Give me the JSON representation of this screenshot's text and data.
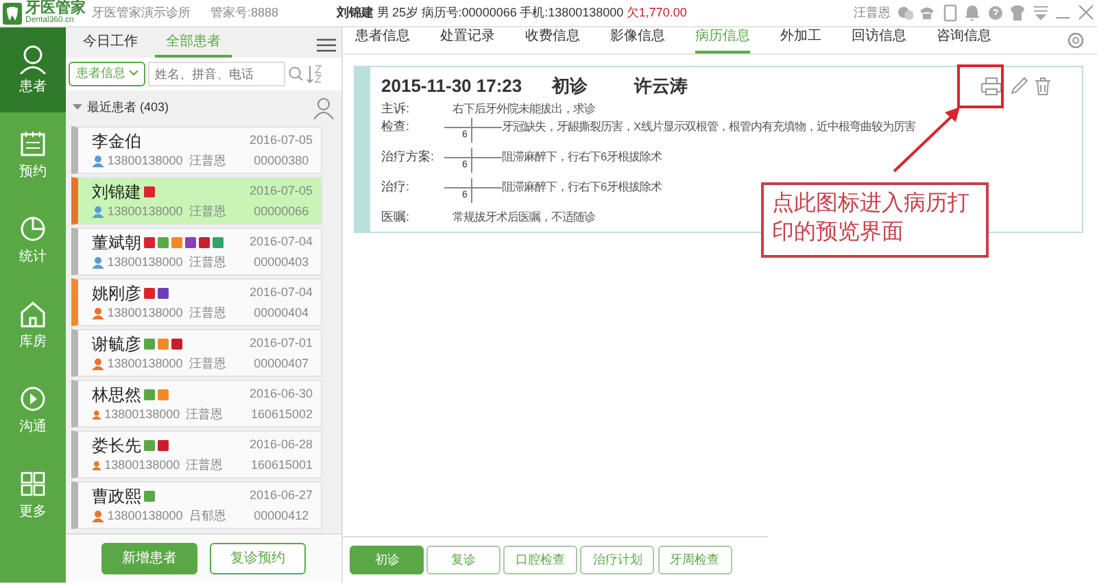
{
  "app": {
    "logo_title": "牙医管家",
    "logo_subtitle": "Dental360.cn",
    "clinic": "牙医管家演示诊所",
    "account": "管家号:8888"
  },
  "patient_header": {
    "name": "刘锦建",
    "gender": "男",
    "age": "25岁",
    "record_no": "病历号:00000066",
    "phone": "手机:13800138000",
    "debt": "欠1,770.00"
  },
  "user": "汪普恩",
  "sidebar": {
    "items": [
      {
        "label": "患者",
        "kind": "person",
        "selected": true
      },
      {
        "label": "预约",
        "kind": "calendar",
        "selected": false
      },
      {
        "label": "统计",
        "kind": "pie",
        "selected": false
      },
      {
        "label": "库房",
        "kind": "house",
        "selected": false
      },
      {
        "label": "沟通",
        "kind": "play",
        "selected": false
      },
      {
        "label": "更多",
        "kind": "grid",
        "selected": false
      }
    ]
  },
  "panel_tabs": [
    {
      "label": "今日工作",
      "selected": false
    },
    {
      "label": "全部患者",
      "selected": true
    }
  ],
  "search": {
    "filter": "患者信息",
    "placeholder": "姓名、拼音、电话"
  },
  "recent": {
    "title": "最近患者 (403)"
  },
  "patients": [
    {
      "name": "李金伯",
      "date": "2016-07-05",
      "phone": "13800138000",
      "doctor": "汪普恩",
      "record_no": "00000380",
      "kind": "male",
      "color": "#b5b5b5",
      "selected": false
    },
    {
      "name": "刘锦建",
      "date": "2016-07-05",
      "phone": "13800138000",
      "doctor": "汪普恩",
      "record_no": "00000066",
      "kind": "male",
      "color": "#e8742a",
      "selected": true,
      "tags": [
        {
          "color": "#d9262e"
        }
      ]
    },
    {
      "name": "董斌朝",
      "date": "2016-07-04",
      "phone": "13800138000",
      "doctor": "汪普恩",
      "record_no": "00000403",
      "kind": "male",
      "color": "#b5b5b5",
      "selected": false,
      "tags": [
        {
          "color": "#d9262e"
        },
        {
          "color": "#5aa845"
        },
        {
          "color": "#ef8a2a"
        },
        {
          "color": "#8c3fb5"
        },
        {
          "color": "#c8202a"
        },
        {
          "color": "#2ea56a"
        }
      ]
    },
    {
      "name": "姚刚彦",
      "date": "2016-07-04",
      "phone": "13800138000",
      "doctor": "汪普恩",
      "record_no": "00000404",
      "kind": "female",
      "color": "#ef8a2a",
      "selected": false,
      "tags": [
        {
          "color": "#d9262e"
        },
        {
          "color": "#6a3fb5"
        }
      ]
    },
    {
      "name": "谢毓彦",
      "date": "2016-07-01",
      "phone": "13800138000",
      "doctor": "汪普恩",
      "record_no": "00000407",
      "kind": "female",
      "color": "#b5b5b5",
      "selected": false,
      "tags": [
        {
          "color": "#5aa845"
        },
        {
          "color": "#ef8a2a"
        },
        {
          "color": "#c8202a"
        }
      ]
    },
    {
      "name": "林思然",
      "date": "2016-06-30",
      "phone": "13800138000",
      "doctor": "汪普恩",
      "record_no": "160615002",
      "kind": "female",
      "color": "#b5b5b5",
      "selected": false,
      "tags": [
        {
          "color": "#5aa845"
        },
        {
          "color": "#ef8a2a"
        }
      ]
    },
    {
      "name": "娄长先",
      "date": "2016-06-28",
      "phone": "13800138000",
      "doctor": "汪普恩",
      "record_no": "160615001",
      "kind": "female",
      "color": "#b5b5b5",
      "selected": false,
      "tags": [
        {
          "color": "#5aa845"
        },
        {
          "color": "#c8202a"
        }
      ]
    },
    {
      "name": "曹政熙",
      "date": "2016-06-27",
      "phone": "13800138000",
      "doctor": "吕郁恩",
      "record_no": "00000412",
      "kind": "female",
      "color": "#b5b5b5",
      "selected": false,
      "tags": [
        {
          "color": "#5aa845"
        }
      ]
    }
  ],
  "panel_buttons": [
    {
      "label": "新增患者",
      "kind": "primary"
    },
    {
      "label": "复诊预约",
      "kind": "outline"
    }
  ],
  "main_tabs": [
    {
      "label": "患者信息",
      "selected": false
    },
    {
      "label": "处置记录",
      "selected": false
    },
    {
      "label": "收费信息",
      "selected": false
    },
    {
      "label": "影像信息",
      "selected": false
    },
    {
      "label": "病历信息",
      "selected": true
    },
    {
      "label": "外加工",
      "selected": false
    },
    {
      "label": "回访信息",
      "selected": false
    },
    {
      "label": "咨询信息",
      "selected": false
    }
  ],
  "record": {
    "datetime": "2015-11-30 17:23",
    "visit_type": "初诊",
    "doctor": "许云涛",
    "fields": [
      {
        "label": "主诉:",
        "kind": "text",
        "text": "右下后牙外院未能拔出，求诊"
      },
      {
        "label": "检查:",
        "kind": "tooth",
        "tooth": "6",
        "text": "牙冠缺失，牙龈撕裂历害，X线片显示双根管，根管内有充填物，近中根弯曲较为厉害"
      },
      {
        "label": "治疗方案:",
        "kind": "tooth",
        "tooth": "6",
        "text": "阻滞麻醉下，行右下6牙根拔除术"
      },
      {
        "label": "治疗:",
        "kind": "tooth",
        "tooth": "6",
        "text": "阻滞麻醉下，行右下6牙根拔除术"
      },
      {
        "label": "医嘱:",
        "kind": "text",
        "text": "常规拔牙术后医嘱，不适随诊"
      }
    ]
  },
  "record_buttons": [
    {
      "label": "初诊",
      "selected": true
    },
    {
      "label": "复诊",
      "selected": false
    },
    {
      "label": "口腔检查",
      "selected": false
    },
    {
      "label": "治疗计划",
      "selected": false
    },
    {
      "label": "牙周检查",
      "selected": false
    }
  ],
  "annotation": {
    "callout": "点此图标进入病历打印的预览界面"
  }
}
